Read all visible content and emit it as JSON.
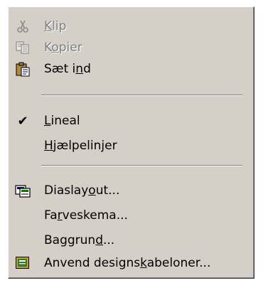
{
  "menu": {
    "items": [
      {
        "pre": "",
        "acc": "K",
        "post": "lip",
        "icon": "scissors-icon",
        "enabled": false
      },
      {
        "pre": "K",
        "acc": "o",
        "post": "pier",
        "icon": "copy-icon",
        "enabled": false
      },
      {
        "pre": "Sæt i",
        "acc": "n",
        "post": "d",
        "icon": "paste-icon",
        "enabled": true
      },
      {
        "pre": "",
        "acc": "L",
        "post": "ineal",
        "icon": "checkmark-icon",
        "enabled": true,
        "checked": true
      },
      {
        "pre": "",
        "acc": "H",
        "post": "jælpelinjer",
        "icon": "",
        "enabled": true
      },
      {
        "pre": "Diaslay",
        "acc": "o",
        "post": "ut...",
        "icon": "slide-layout-icon",
        "enabled": true
      },
      {
        "pre": "Fa",
        "acc": "r",
        "post": "veskema...",
        "icon": "",
        "enabled": true
      },
      {
        "pre": "Baggrun",
        "acc": "d",
        "post": "...",
        "icon": "",
        "enabled": true
      },
      {
        "pre": "Anvend designs",
        "acc": "k",
        "post": "abeloner...",
        "icon": "design-template-icon",
        "enabled": true
      }
    ],
    "check_glyph": "✔",
    "colors": {
      "face": "#d4d0c8",
      "disabled_text": "#808080"
    }
  }
}
